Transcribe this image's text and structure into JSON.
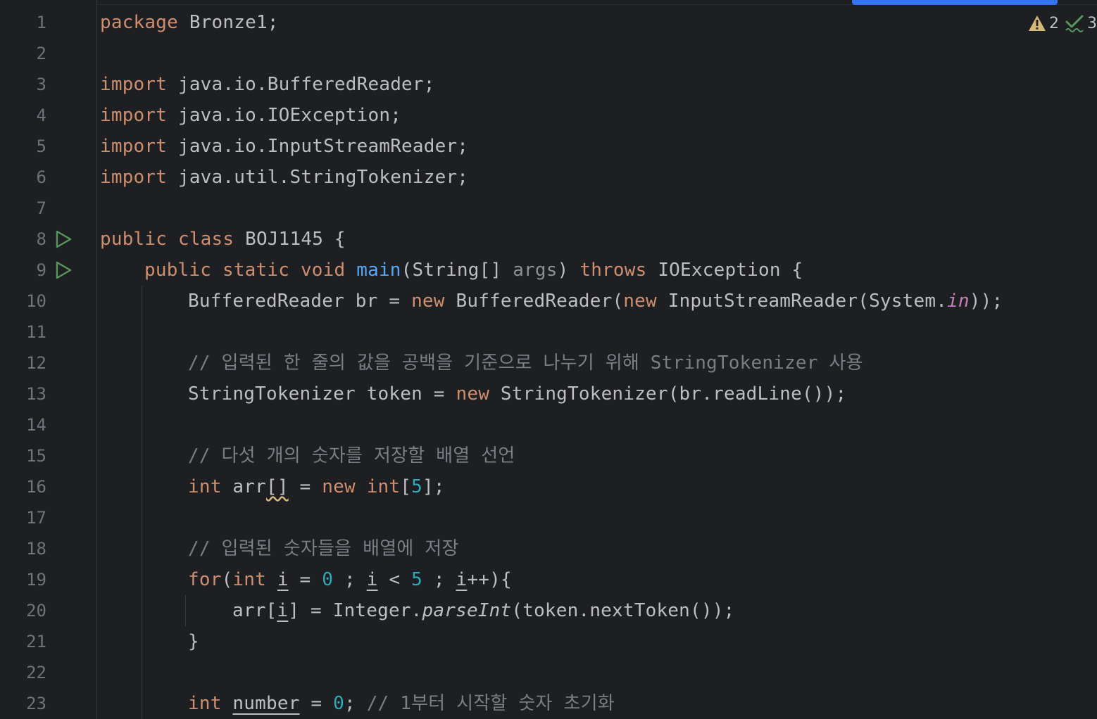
{
  "status": {
    "warnings_icon": "warning-triangle-icon",
    "warnings_count": "2",
    "checks_icon": "check-icon",
    "checks_count": "3"
  },
  "gutter": {
    "line_numbers": [
      "1",
      "2",
      "3",
      "4",
      "5",
      "6",
      "7",
      "8",
      "9",
      "10",
      "11",
      "12",
      "13",
      "14",
      "15",
      "16",
      "17",
      "18",
      "19",
      "20",
      "21",
      "22",
      "23"
    ],
    "run_icons": [
      "run-class-icon",
      "run-main-icon"
    ]
  },
  "code": {
    "l1_kw": "package",
    "l1_rest": " Bronze1;",
    "l3_kw": "import",
    "l3_rest": " java.io.BufferedReader;",
    "l4_kw": "import",
    "l4_rest": " java.io.IOException;",
    "l5_kw": "import",
    "l5_rest": " java.io.InputStreamReader;",
    "l6_kw": "import",
    "l6_rest": " java.util.StringTokenizer;",
    "l8_kw": "public class",
    "l8_rest": " BOJ1145 {",
    "l9_kw1": "public static void",
    "l9_fn": "main",
    "l9_a": "(String[] ",
    "l9_param": "args",
    "l9_b": ") ",
    "l9_kw2": "throws",
    "l9_c": " IOException {",
    "l10_a": "BufferedReader br = ",
    "l10_kw1": "new",
    "l10_b": " BufferedReader(",
    "l10_kw2": "new",
    "l10_c": " InputStreamReader(System.",
    "l10_field": "in",
    "l10_d": "));",
    "l12_cm": "// 입력된 한 줄의 값을 공백을 기준으로 나누기 위해 StringTokenizer 사용",
    "l13_a": "StringTokenizer token = ",
    "l13_kw": "new",
    "l13_b": " StringTokenizer(br.readLine());",
    "l15_cm": "// 다섯 개의 숫자를 저장할 배열 선언",
    "l16_kw1": "int",
    "l16_a": " arr",
    "l16_br": "[]",
    "l16_b": " = ",
    "l16_kw2": "new",
    "l16_c": " ",
    "l16_kw3": "int",
    "l16_d": "[",
    "l16_num": "5",
    "l16_e": "];",
    "l18_cm": "// 입력된 숫자들을 배열에 저장",
    "l19_kw1": "for",
    "l19_a": "(",
    "l19_kw2": "int",
    "l19_b": " ",
    "l19_i1": "i",
    "l19_c": " = ",
    "l19_num1": "0",
    "l19_d": " ; ",
    "l19_i2": "i",
    "l19_e": " < ",
    "l19_num2": "5",
    "l19_f": " ; ",
    "l19_i3": "i",
    "l19_g": "++){",
    "l20_a": "arr[",
    "l20_i": "i",
    "l20_b": "] = Integer.",
    "l20_call": "parseInt",
    "l20_c": "(token.nextToken());",
    "l21": "}",
    "l23_kw": "int",
    "l23_a": " ",
    "l23_var": "number",
    "l23_b": " = ",
    "l23_num": "0",
    "l23_c": "; ",
    "l23_cm": "// 1부터 시작할 숫자 초기화"
  }
}
